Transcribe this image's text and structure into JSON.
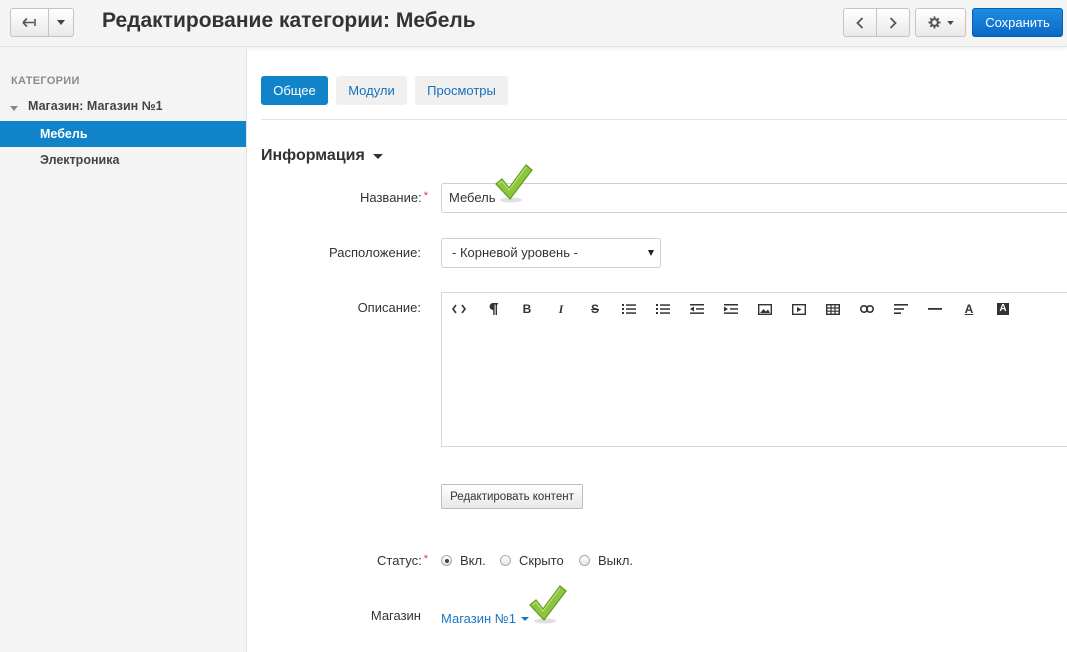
{
  "header": {
    "title": "Редактирование категории: Мебель",
    "save_label": "Сохранить",
    "icons": [
      "back-arrow-icon",
      "caret-down-icon",
      "chevron-left-icon",
      "chevron-right-icon",
      "gear-icon"
    ]
  },
  "sidebar": {
    "heading": "КАТЕГОРИИ",
    "root": "Магазин: Магазин №1",
    "items": [
      {
        "label": "Мебель",
        "active": true
      },
      {
        "label": "Электроника",
        "active": false
      }
    ]
  },
  "tabs": [
    {
      "label": "Общее",
      "active": true
    },
    {
      "label": "Модули",
      "active": false
    },
    {
      "label": "Просмотры",
      "active": false
    }
  ],
  "section": {
    "title": "Информация"
  },
  "form": {
    "name_label": "Название:",
    "name_value": "Мебель",
    "location_label": "Расположение:",
    "location_value": "- Корневой уровень -",
    "description_label": "Описание:",
    "edit_content_label": "Редактировать контент",
    "status_label": "Статус:",
    "status_options": [
      {
        "label": "Вкл.",
        "checked": true
      },
      {
        "label": "Скрыто",
        "checked": false
      },
      {
        "label": "Выкл.",
        "checked": false
      }
    ],
    "store_label": "Магазин",
    "store_value": "Магазин №1"
  },
  "editor_toolbar": [
    "code-view-icon",
    "paragraph-icon",
    "bold-icon",
    "italic-icon",
    "strikethrough-icon",
    "bullet-list-icon",
    "numbered-list-icon",
    "outdent-icon",
    "indent-icon",
    "image-icon",
    "video-icon",
    "table-icon",
    "link-icon",
    "align-icon",
    "horizontal-rule-icon",
    "font-color-icon",
    "background-color-icon"
  ],
  "colors": {
    "primary": "#1183c8",
    "save": "#0b67c9",
    "link": "#1a78c2",
    "checkmark": "#8cc63f",
    "required": "#e53935"
  }
}
